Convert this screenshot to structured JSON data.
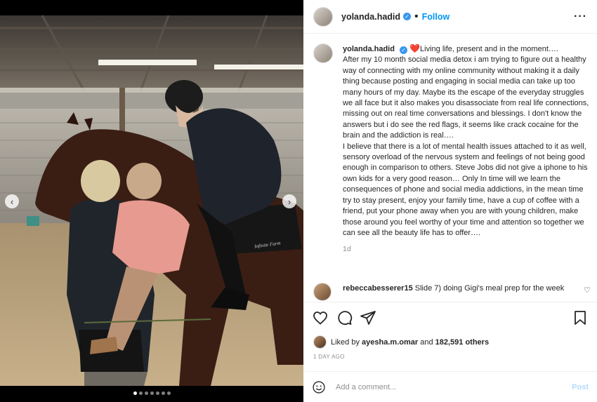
{
  "post": {
    "username": "yolanda.hadid",
    "follow_label": "Follow",
    "separator": "•",
    "more_icon": "more-horizontal-icon",
    "verified_color": "#3897f0"
  },
  "photo": {
    "watermark": "Infinite Farm",
    "slides_total": 7,
    "active_slide": 1
  },
  "caption": {
    "username": "yolanda.hadid",
    "heart": "❤️",
    "text": "Living life, present and in the moment….\nAfter my 10 month social media detox i am trying to figure out a healthy way of connecting with my online community without making it a daily thing because posting and engaging in social media can take up too many hours of my day. Maybe its the escape of the everyday struggles we all face but it also makes you disassociate from real life connections, missing out on real time conversations and blessings. I don't know the answers but i do see the red flags, it seems like crack cocaine for the brain and the addiction is real….\nI believe that there is a lot of mental health issues attached to it as well, sensory overload of the nervous system and feelings of not being good enough in comparison to others. Steve Jobs did not give a iphone to his own kids for a very good reason… Only In time will we learn the consequences of phone and social media addictions, in the mean time try to stay present, enjoy your family time, have a cup of coffee with a friend, put your phone away when you are with young children, make those around you feel worthy of your time and attention so together we can see all the beauty life has to offer….",
    "time": "1d"
  },
  "comment": {
    "username": "rebeccabesserer15",
    "text": "Slide 7) doing Gigi's meal prep for the week"
  },
  "likes": {
    "prefix": "Liked by",
    "user": "ayesha.m.omar",
    "connector": "and",
    "count": "182,591 others"
  },
  "date": "1 DAY AGO",
  "add_comment": {
    "placeholder": "Add a comment...",
    "post_label": "Post"
  },
  "colors": {
    "accent": "#0095f6",
    "post_disabled": "#b3dbff",
    "heart": "#e0245e"
  }
}
